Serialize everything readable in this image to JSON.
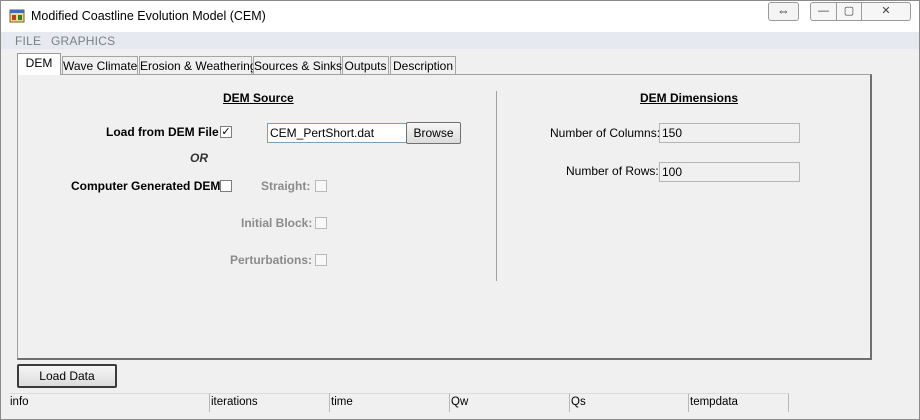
{
  "window": {
    "title": "Modified Coastline Evolution Model (CEM)",
    "extra_button_glyph": "⇔",
    "min_glyph": "—",
    "max_glyph": "▢",
    "close_glyph": "✕"
  },
  "menu": {
    "items": [
      "FILE",
      "GRAPHICS"
    ]
  },
  "tabs": [
    {
      "label": "DEM",
      "active": true
    },
    {
      "label": "Wave Climate"
    },
    {
      "label": "Erosion & Weathering"
    },
    {
      "label": "Sources & Sinks"
    },
    {
      "label": "Outputs"
    },
    {
      "label": "Description"
    }
  ],
  "dem_source": {
    "heading": "DEM Source",
    "load_from_file_label": "Load from DEM File",
    "load_from_file_checked": true,
    "file_value": "CEM_PertShort.dat",
    "browse_label": "Browse",
    "or_label": "OR",
    "computer_generated_label": "Computer Generated DEM",
    "straight_label": "Straight:",
    "initial_block_label": "Initial Block:",
    "perturbations_label": "Perturbations:",
    "check_glyph": "✓"
  },
  "dem_dimensions": {
    "heading": "DEM Dimensions",
    "columns_label": "Number of Columns:",
    "columns_value": "150",
    "rows_label": "Number of Rows:",
    "rows_value": "100"
  },
  "load_data_label": "Load Data",
  "status": [
    "info",
    "iterations",
    "time",
    "Qw",
    "Qs",
    "tempdata"
  ],
  "icons": {
    "app": "app-window-icon",
    "extra": "arrows-horizontal-icon"
  },
  "colors": {
    "window_bg": "#f0f0f0",
    "menu_bg": "#e6e9f0",
    "menu_text": "#7b7f88",
    "disabled_text": "#8b8b8b"
  }
}
